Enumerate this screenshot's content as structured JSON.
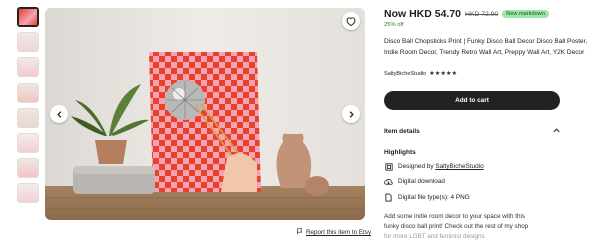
{
  "thumbnails": [
    {
      "name": "thumbnail-1",
      "active": true
    },
    {
      "name": "thumbnail-2",
      "active": false
    },
    {
      "name": "thumbnail-3",
      "active": false
    },
    {
      "name": "thumbnail-4",
      "active": false
    },
    {
      "name": "thumbnail-5",
      "active": false
    },
    {
      "name": "thumbnail-6",
      "active": false
    },
    {
      "name": "thumbnail-7",
      "active": false
    },
    {
      "name": "thumbnail-8",
      "active": false
    }
  ],
  "image": {
    "favorite_icon": "heart-icon",
    "prev_icon": "chevron-left-icon",
    "next_icon": "chevron-right-icon"
  },
  "report": {
    "label": "Report this item to Etsy",
    "icon": "flag-icon"
  },
  "product": {
    "price_now": "Now HKD 54.70",
    "price_old": "HKD 72.90",
    "sale_badge": "New markdown",
    "discount": "25% off",
    "title": "Disco Ball Chopsticks Print | Funky Disco Ball Decor Disco Ball Poster, Indie Room Decor, Trendy Retro Wall Art, Preppy Wall Art, Y2K Decor",
    "shop_name": "SaltyBicheStudio",
    "rating_stars": "★★★★★",
    "add_to_cart": "Add to cart"
  },
  "details": {
    "heading": "Item details",
    "chevron_icon": "chevron-up-icon",
    "highlights_heading": "Highlights",
    "designed_by_prefix": "Designed by",
    "designed_by_shop": "SaltyBicheStudio",
    "digital_download": "Digital download",
    "file_types": "Digital file type(s): 4 PNG",
    "description_line1": "Add some indie room decor to your space with this",
    "description_line2": "funky disco ball print! Check out the rest of my shop",
    "description_line3": "for more LGBT and feminist designs"
  },
  "colors": {
    "accent_dark": "#222222",
    "sale_green": "#9ee5a8",
    "discount_green": "#2f7d32",
    "poster_red": "#e8432a",
    "poster_pink": "#f4a3b4"
  }
}
